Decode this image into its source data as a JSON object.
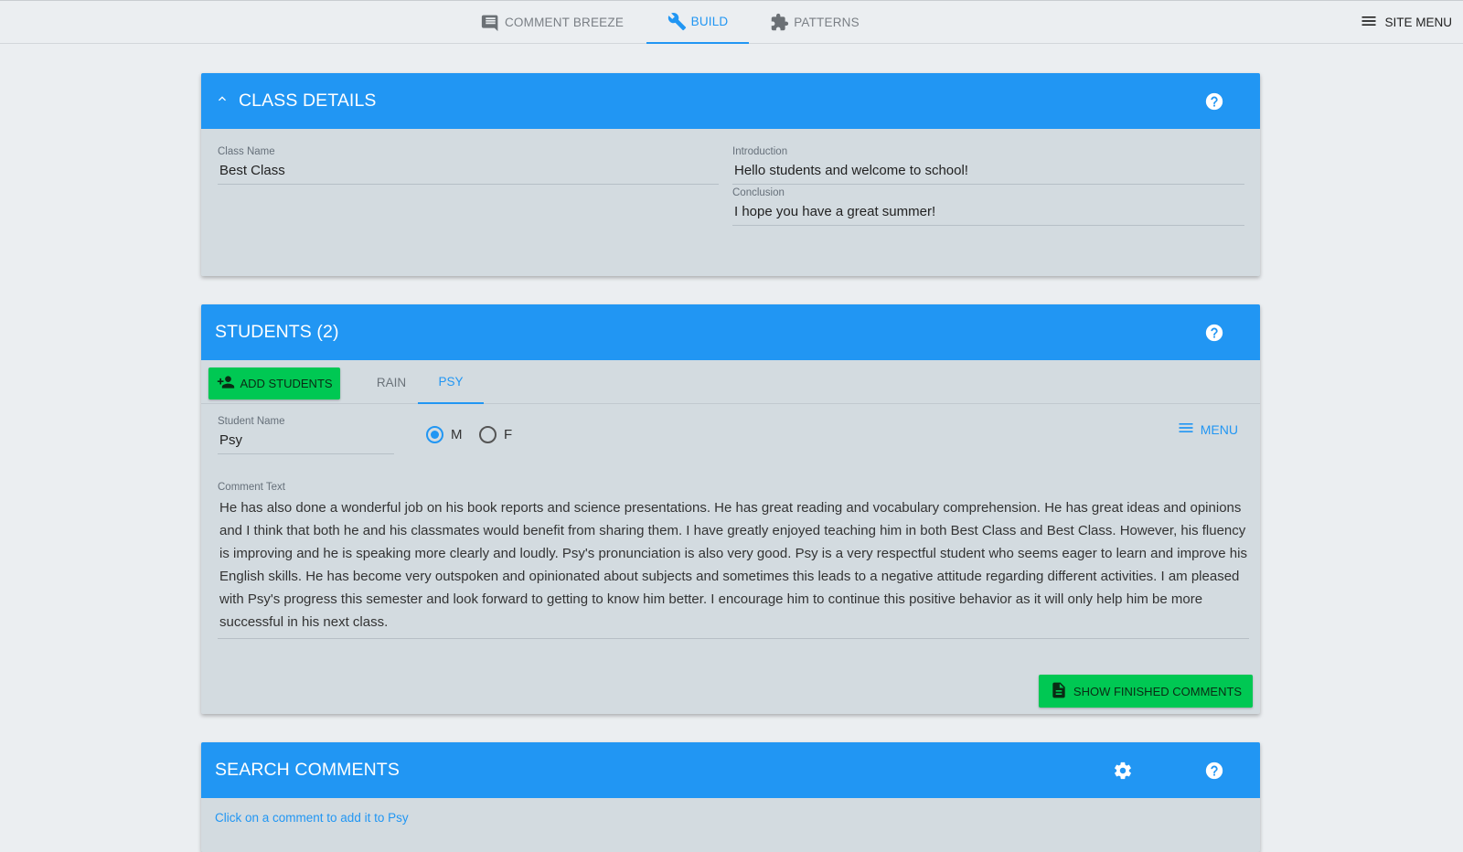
{
  "nav": {
    "tabs": [
      {
        "label": "COMMENT BREEZE",
        "icon": "comment-icon"
      },
      {
        "label": "BUILD",
        "icon": "wrench-icon",
        "active": true
      },
      {
        "label": "PATTERNS",
        "icon": "puzzle-icon"
      }
    ],
    "site_menu_label": "SITE MENU"
  },
  "colors": {
    "primary": "#2196f3",
    "action_green": "#00c853",
    "card_bg": "#d3dbe0",
    "page_bg": "#ebeef1"
  },
  "class_details": {
    "title": "CLASS DETAILS",
    "class_name_label": "Class Name",
    "class_name_value": "Best Class",
    "introduction_label": "Introduction",
    "introduction_value": "Hello students and welcome to school!",
    "conclusion_label": "Conclusion",
    "conclusion_value": "I hope you have a great summer!"
  },
  "students": {
    "title": "STUDENTS (2)",
    "add_label": "ADD STUDENTS",
    "tabs": [
      {
        "label": "RAIN"
      },
      {
        "label": "PSY",
        "active": true
      }
    ],
    "student_name_label": "Student Name",
    "student_name_value": "Psy",
    "gender_options": [
      {
        "label": "M",
        "selected": true
      },
      {
        "label": "F",
        "selected": false
      }
    ],
    "menu_label": "MENU",
    "comment_label": "Comment Text",
    "comment_text": "He has also done a wonderful job on his book reports and science presentations. He has great reading and vocabulary comprehension. He has great ideas and opinions and I think that both he and his classmates would benefit from sharing them. I have greatly enjoyed teaching him in both Best Class and Best Class. However, his fluency is improving and he is speaking more clearly and loudly. Psy's pronunciation is also very good. Psy is a very respectful student who seems eager to learn and improve his English skills. He has become very outspoken and opinionated about subjects and sometimes this leads to a negative attitude regarding different activities. I am pleased with Psy's progress this semester and look forward to getting to know him better. I encourage him to continue this positive behavior as it will only help him be more successful in his next class.",
    "show_finished_label": "SHOW FINISHED COMMENTS"
  },
  "search": {
    "title": "SEARCH COMMENTS",
    "hint": "Click on a comment to add it to Psy"
  }
}
